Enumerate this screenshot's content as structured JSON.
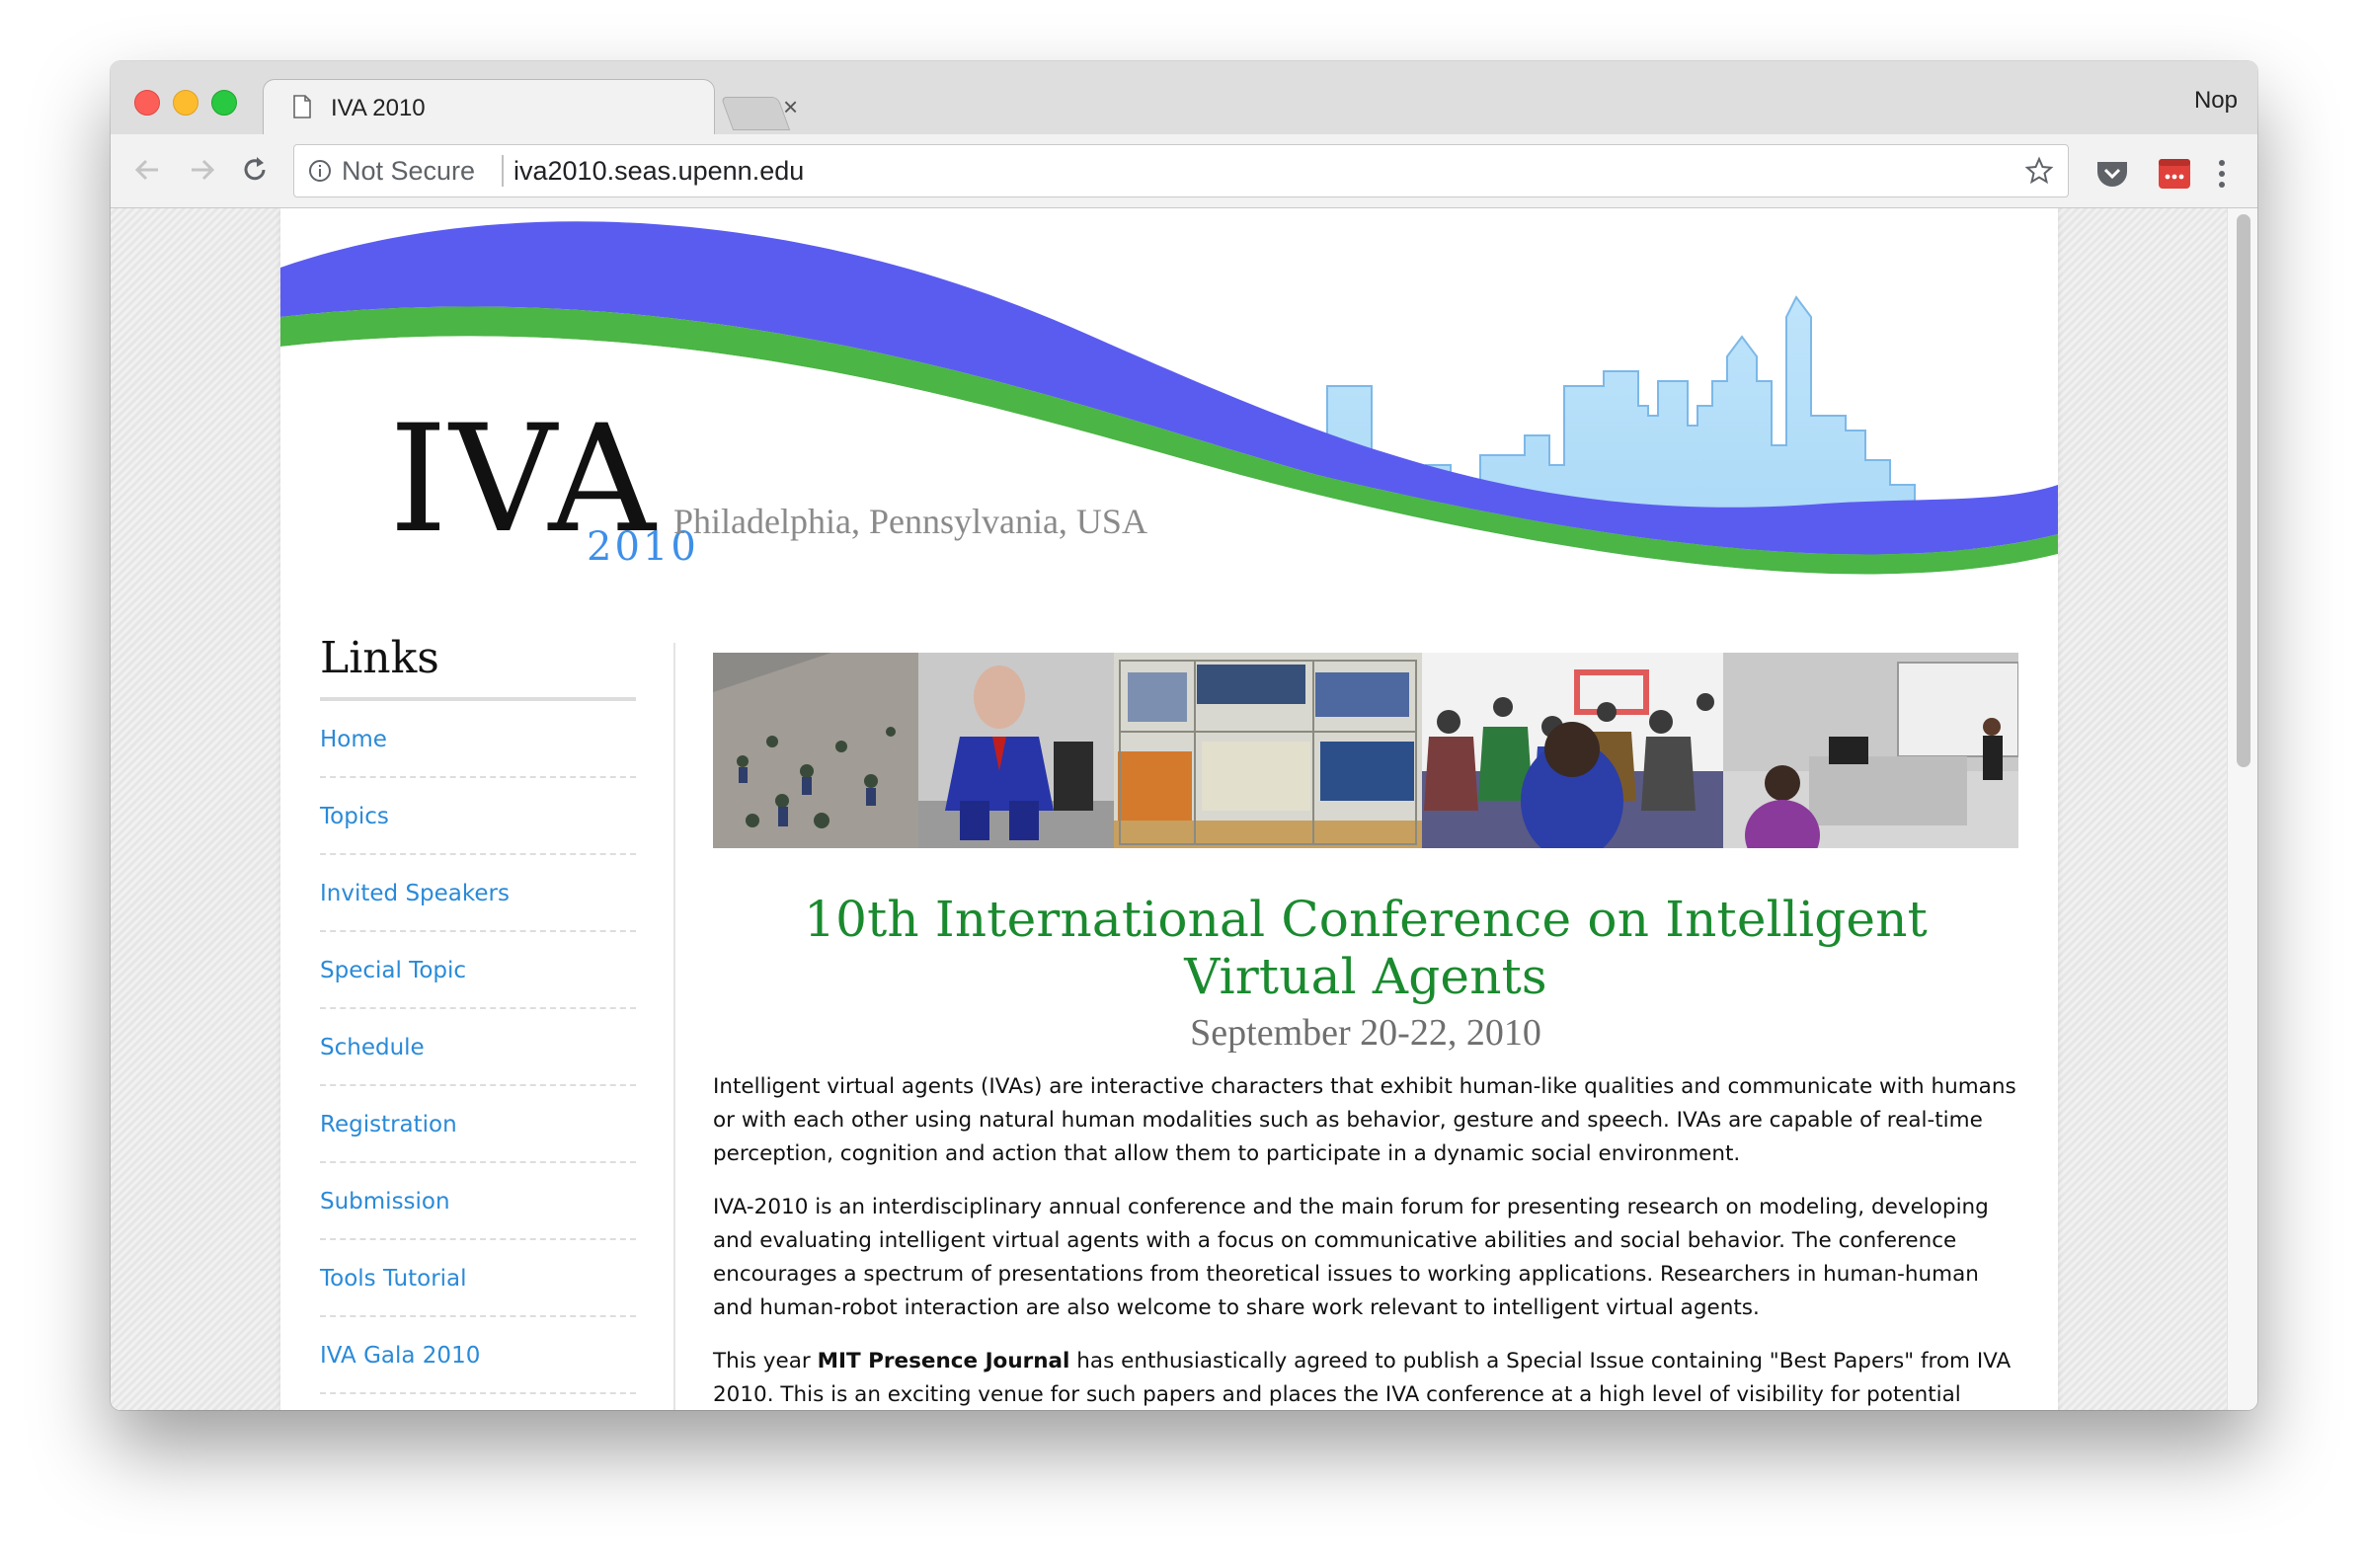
{
  "browser": {
    "tab_title": "IVA 2010",
    "tab_close": "×",
    "profile_name": "Nop",
    "security_label": "Not Secure",
    "url": "iva2010.seas.upenn.edu"
  },
  "header": {
    "logo_text": "IVA",
    "logo_year": "2010",
    "location": "Philadelphia, Pennsylvania, USA"
  },
  "sidebar": {
    "title": "Links",
    "items": [
      {
        "label": "Home"
      },
      {
        "label": "Topics"
      },
      {
        "label": "Invited Speakers"
      },
      {
        "label": "Special Topic"
      },
      {
        "label": "Schedule"
      },
      {
        "label": "Registration"
      },
      {
        "label": "Submission"
      },
      {
        "label": "Tools Tutorial"
      },
      {
        "label": "IVA Gala 2010"
      }
    ]
  },
  "main": {
    "title": "10th International Conference on Intelligent Virtual Agents",
    "date": "September 20-22, 2010",
    "para1": "Intelligent virtual agents (IVAs) are interactive characters that exhibit human-like qualities and communicate with humans or with each other using natural human modalities such as behavior, gesture and speech. IVAs are capable of real-time perception, cognition and action that allow them to participate in a dynamic social environment.",
    "para2": "IVA-2010 is an interdisciplinary annual conference and the main forum for presenting research on modeling, developing and evaluating intelligent virtual agents with a focus on communicative abilities and social behavior. The conference encourages a spectrum of presentations from theoretical issues to working applications. Researchers in human-human and human-robot interaction are also welcome to share work relevant to intelligent virtual agents.",
    "para3_pre": "This year ",
    "para3_bold": "MIT Presence Journal",
    "para3_post": " has enthusiastically agreed to publish a Special Issue containing \"Best Papers\" from IVA 2010. This is an exciting venue for such papers and places the IVA conference at a high level of visibility for potential authors as well as for the IVA field at large."
  },
  "colors": {
    "banner_blue": "#5a5cf0",
    "banner_green": "#4bb545",
    "skyline": "#a9d8f5",
    "title_green": "#1a8a2e",
    "link_blue": "#2a8ad8"
  }
}
